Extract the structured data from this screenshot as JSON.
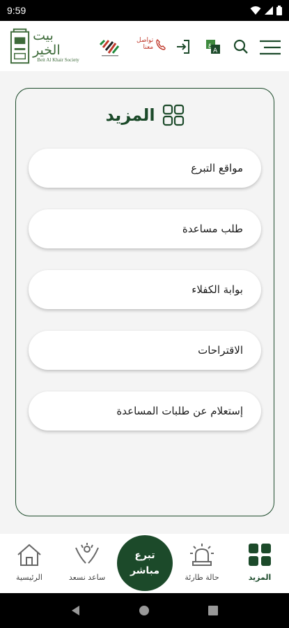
{
  "status_bar": {
    "time": "9:59"
  },
  "header": {
    "logo_ar": "بيت الخير",
    "logo_en": "Beit Al Khair Society",
    "emergency_line1": "تواصل",
    "emergency_line2": "معنا"
  },
  "more_page": {
    "title": "المزيد",
    "items": [
      {
        "label": "مواقع التبرع"
      },
      {
        "label": "طلب مساعدة"
      },
      {
        "label": "بوابة الكفلاء"
      },
      {
        "label": "الاقتراحات"
      },
      {
        "label": "إستعلام عن طلبات المساعدة"
      }
    ]
  },
  "bottom_nav": {
    "home": "الرئيسية",
    "help": "ساعد نسعد",
    "donate_line1": "تبرع",
    "donate_line2": "مباشر",
    "emergency": "حالة طارئة",
    "more": "المزيد"
  },
  "colors": {
    "primary": "#1c4a2a",
    "background": "#f4f4f4",
    "accent_red": "#c0392b"
  }
}
